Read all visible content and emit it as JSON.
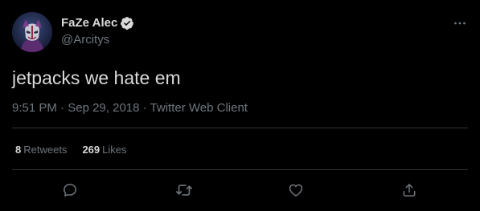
{
  "author": {
    "display_name": "FaZe Alec",
    "handle": "@Arcitys",
    "verified": true
  },
  "tweet": {
    "text": "jetpacks we hate em",
    "time": "9:51 PM",
    "separator": "·",
    "date": "Sep 29, 2018",
    "client": "Twitter Web Client"
  },
  "stats": {
    "retweets_count": "8",
    "retweets_label": "Retweets",
    "likes_count": "269",
    "likes_label": "Likes"
  },
  "actions": {
    "reply_icon": "reply-icon",
    "retweet_icon": "retweet-icon",
    "like_icon": "heart-icon",
    "share_icon": "share-icon"
  },
  "colors": {
    "background": "#000000",
    "text_primary": "#d9d9d9",
    "text_secondary": "#6e767d",
    "divider": "#2f3336",
    "verified": "#d9d9d9"
  }
}
